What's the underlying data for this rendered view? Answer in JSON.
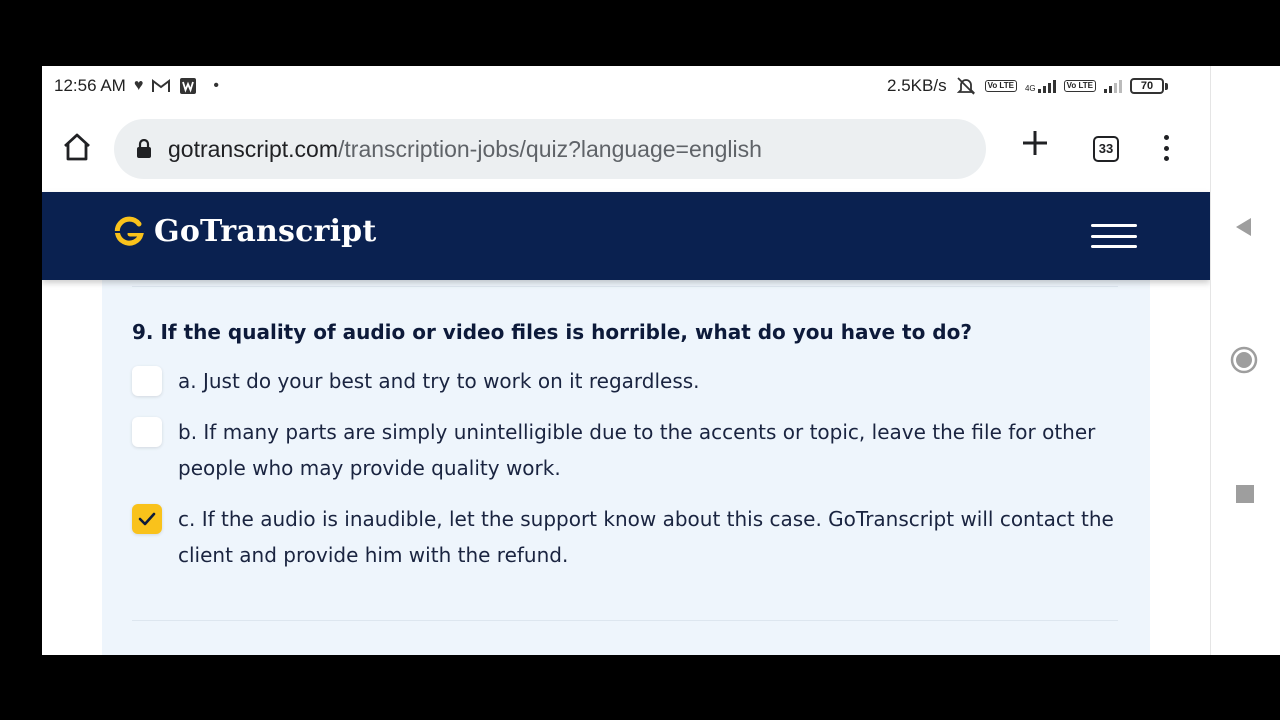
{
  "status_bar": {
    "time": "12:56 AM",
    "left_icons": [
      "heart-icon",
      "gmail-icon",
      "w-app-icon",
      "dot-icon"
    ],
    "net_speed": "2.5KB/s",
    "net_type": "4G",
    "volte1": "Vo LTE",
    "volte2": "Vo LTE",
    "battery": "70"
  },
  "browser": {
    "url_host": "gotranscript.com",
    "url_path": "/transcription-jobs/quiz?language=english",
    "tab_count": "33"
  },
  "site": {
    "brand": "GoTranscript",
    "brand_color": "#0a2150",
    "accent_color": "#f9c21b"
  },
  "quiz": {
    "question": "9. If the quality of audio or video files is horrible, what do you have to do?",
    "options": [
      {
        "text": "a. Just do your best and try to work on it regardless.",
        "checked": false
      },
      {
        "text": "b. If many parts are simply unintelligible due to the accents or topic, leave the file for other people who may provide quality work.",
        "checked": false
      },
      {
        "text": "c. If the audio is inaudible, let the support know about this case. GoTranscript will contact the client and provide him with the refund.",
        "checked": true
      }
    ]
  },
  "android_nav": [
    "back-icon",
    "home-circle-icon",
    "recents-square-icon"
  ]
}
